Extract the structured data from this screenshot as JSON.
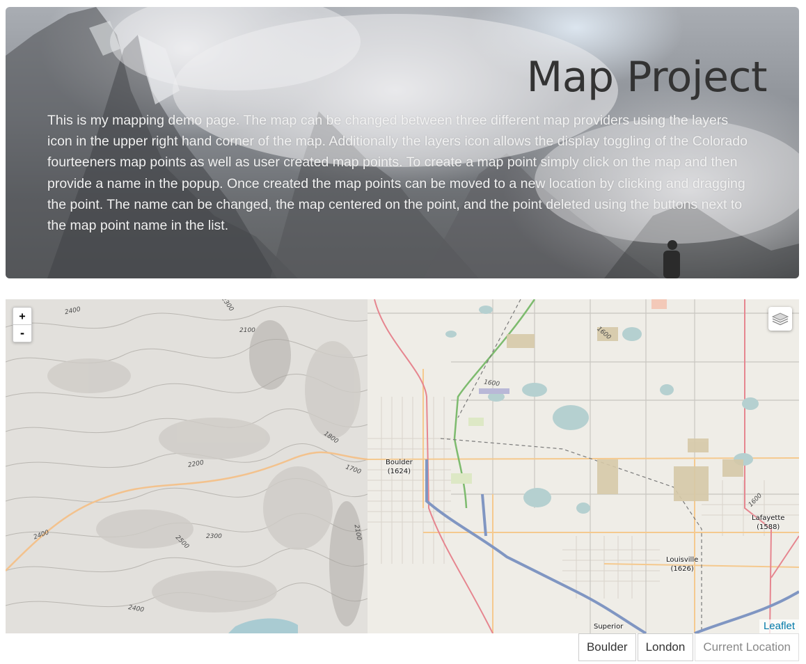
{
  "hero": {
    "title": "Map Project",
    "description": "This is my mapping demo page. The map can be changed between three different map providers using the layers icon in the upper right hand corner of the map. Additionally the layers icon allows the display toggling of the Colorado fourteeners map points as well as user created map points. To create a map point simply click on the map and then provide a name in the popup. Once created the map points can be moved to a new location by clicking and dragging the point. The name can be changed, the map centered on the point, and the point deleted using the buttons next to the map point name in the list."
  },
  "map": {
    "zoom_in": "+",
    "zoom_out": "-",
    "layers_icon": "layers-icon",
    "attribution": "Leaflet",
    "places": [
      {
        "name": "Boulder",
        "elev": "(1624)"
      },
      {
        "name": "Lafayette",
        "elev": "(1588)"
      },
      {
        "name": "Louisville",
        "elev": "(1626)"
      },
      {
        "name": "Superior",
        "elev": ""
      }
    ],
    "contours": [
      "2400",
      "2300",
      "2100",
      "1600",
      "1600",
      "1800",
      "2200",
      "1700",
      "1600",
      "2400",
      "2500",
      "2300",
      "2100",
      "2400"
    ]
  },
  "buttons": {
    "boulder": "Boulder",
    "london": "London",
    "current_location": "Current Location"
  },
  "colors": {
    "attribution_link": "#0078a8",
    "highway": "#8096c2",
    "major_road": "#e6858f",
    "minor_road": "#f5c98e",
    "rail_green": "#7dbb6e",
    "water": "#b5d0d0",
    "map_background": "#eeebe4"
  }
}
